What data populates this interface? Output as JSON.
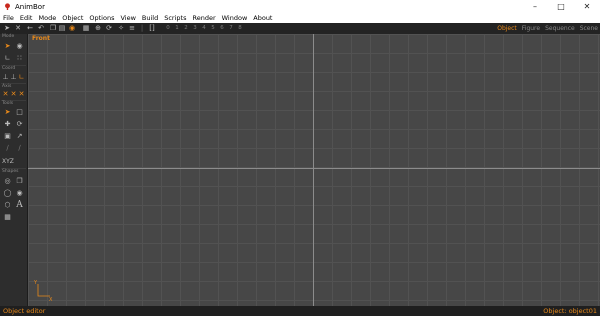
{
  "window": {
    "title": "AnimBor",
    "controls": [
      "minimize",
      "maximize",
      "close"
    ]
  },
  "menu": [
    "File",
    "Edit",
    "Mode",
    "Object",
    "Options",
    "View",
    "Build",
    "Scripts",
    "Render",
    "Window",
    "About"
  ],
  "toolbar": {
    "icons": [
      "cursor-icon",
      "cross-icon",
      "arrow-left-icon",
      "undo-icon",
      "copy-icon",
      "paste-icon",
      "circle-icon",
      "grid-icon",
      "crosshair-icon",
      "rotate-icon",
      "wand-icon",
      "equals-icon",
      "sep-icon",
      "frame-icon"
    ],
    "frames": [
      "0",
      "1",
      "2",
      "3",
      "4",
      "5",
      "6",
      "7",
      "8"
    ]
  },
  "view_tabs": [
    {
      "label": "Object",
      "active": true
    },
    {
      "label": "Figure",
      "active": false
    },
    {
      "label": "Sequence",
      "active": false
    },
    {
      "label": "Scene",
      "active": false
    }
  ],
  "left_panel": {
    "mode_label": "Mode",
    "coord_label": "Coord",
    "axis_label": "Axis",
    "tools_label": "Tools",
    "shapes_label": "Shapes",
    "axis_xyz": "XYZ"
  },
  "viewport": {
    "label": "Front",
    "axis_x": "X",
    "axis_y": "Y"
  },
  "colors": {
    "accent": "#e8891a",
    "viewport_bg": "#474747",
    "grid": "#525252"
  },
  "status": {
    "left": "Object editor",
    "right": "Object: object01"
  }
}
